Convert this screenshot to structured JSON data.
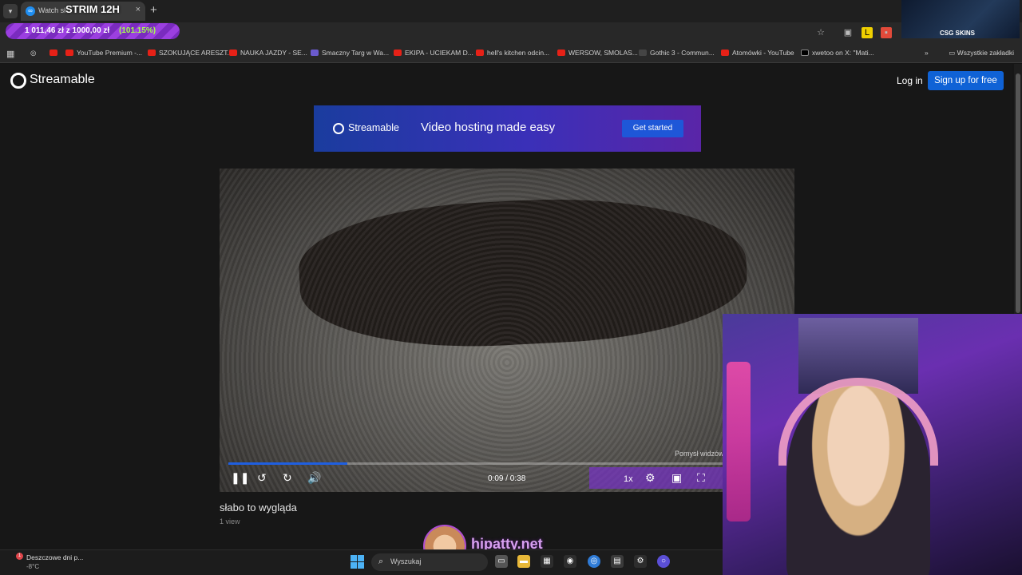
{
  "browser": {
    "tab_title": "Watch sł",
    "tab_favicon": "streamable-icon",
    "tab_close": "×",
    "new_tab": "+",
    "menu_glyph": "▾",
    "star": "☆"
  },
  "bookmarks": {
    "items": [
      {
        "label": "YouTube Premium -...",
        "icon": "youtube-icon"
      },
      {
        "label": "SZOKUJĄCE ARESZT...",
        "icon": "youtube-icon"
      },
      {
        "label": "NAUKA JAZDY - SE...",
        "icon": "youtube-icon"
      },
      {
        "label": "Smaczny Targ w Wa...",
        "icon": "site-icon"
      },
      {
        "label": "EKIPA - UCIEKAM D...",
        "icon": "youtube-icon"
      },
      {
        "label": "hell's kitchen odcin...",
        "icon": "youtube-icon"
      },
      {
        "label": "WERSOW, SMOLAS...",
        "icon": "youtube-icon"
      },
      {
        "label": "Gothic 3 - Commun...",
        "icon": "site-icon"
      },
      {
        "label": "Atomówki - YouTube",
        "icon": "youtube-icon"
      },
      {
        "label": "xwetoo on X: \"Mati...",
        "icon": "x-icon"
      }
    ],
    "more": "»",
    "all_bookmarks": "Wszystkie zakładki"
  },
  "stream_overlay": {
    "title": "STRIM 12H",
    "donation": "1 011,46 zł z 1000,00 zł",
    "donation_percent": "(101.15%)",
    "sponsor": "CSG SKINS",
    "handle": "hipatty.net"
  },
  "site": {
    "logo": "Streamable",
    "login": "Log in",
    "signup": "Sign up for free",
    "banner_logo": "Streamable",
    "banner_tagline": "Video hosting made easy",
    "banner_button": "Get started"
  },
  "video": {
    "time": "0:09 / 0:38",
    "speed": "1x",
    "watermark": "Pomysł widzów",
    "progress": 0.24,
    "title": "słabo to wygląda",
    "views": "1 view"
  },
  "taskbar": {
    "weather_title": "Deszczowe dni p...",
    "weather_temp": "-8°C",
    "weather_badge": "1",
    "search_placeholder": "Wyszukaj"
  },
  "colors": {
    "accent": "#0f62d6",
    "banner_start": "#1a3c9e",
    "banner_end": "#5a25a8",
    "page_bg": "#171717"
  }
}
